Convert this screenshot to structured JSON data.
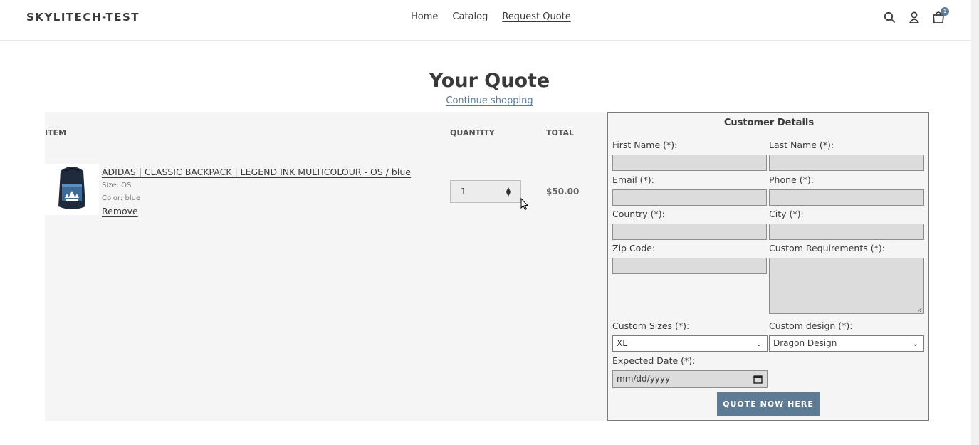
{
  "header": {
    "logo": "SKYLITECH-TEST",
    "nav": [
      "Home",
      "Catalog",
      "Request Quote"
    ],
    "cart_count": "1",
    "icons": [
      "search-icon",
      "account-icon",
      "cart-icon"
    ]
  },
  "page": {
    "title": "Your Quote",
    "continue_link": "Continue shopping"
  },
  "cart": {
    "headers": {
      "item": "ITEM",
      "quantity": "QUANTITY",
      "total": "TOTAL"
    },
    "item": {
      "title": "ADIDAS | CLASSIC BACKPACK | LEGEND INK MULTICOLOUR - OS / blue",
      "size": "Size: OS",
      "color": "Color: blue",
      "remove": "Remove",
      "quantity": "1",
      "total": "$50.00"
    }
  },
  "form": {
    "title": "Customer Details",
    "first_name": "First Name (*):",
    "last_name": "Last Name (*):",
    "email": "Email (*):",
    "phone": "Phone (*):",
    "country": "Country (*):",
    "city": "City (*):",
    "zip": "Zip Code:",
    "requirements": "Custom Requirements (*):",
    "sizes_label": "Custom Sizes (*):",
    "sizes_value": "XL",
    "design_label": "Custom design (*):",
    "design_value": "Dragon Design",
    "date_label": "Expected Date (*):",
    "date_placeholder": "mm/dd/yyyy",
    "submit": "QUOTE NOW HERE"
  },
  "colors": {
    "accent": "#5d7b94",
    "panel": "#f5f5f5",
    "input": "#dcdcdc"
  }
}
